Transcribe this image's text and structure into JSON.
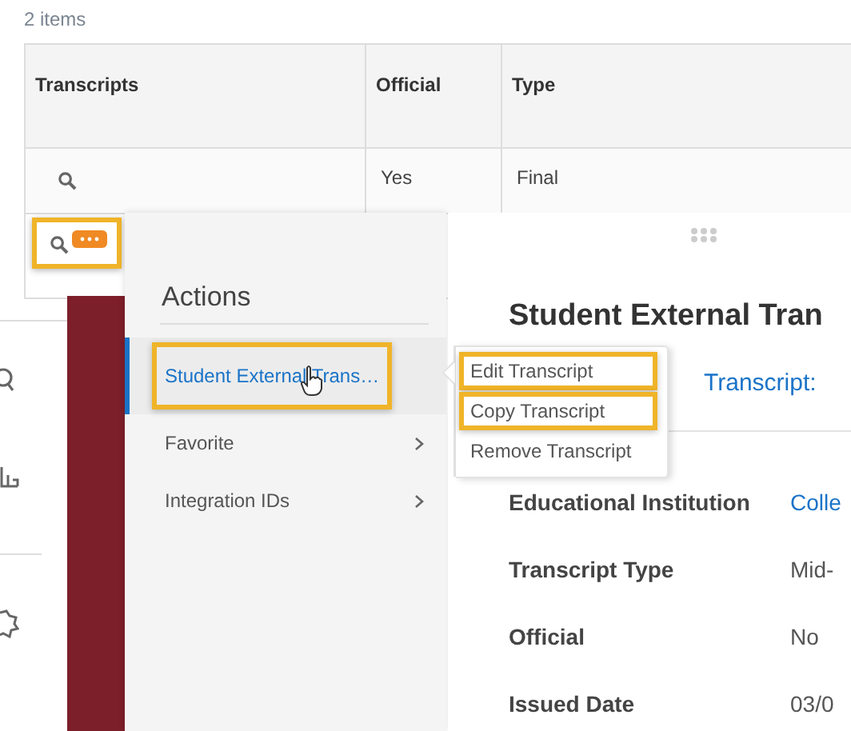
{
  "item_count": "2 items",
  "table": {
    "columns": [
      "Transcripts",
      "Official",
      "Type"
    ],
    "rows": [
      {
        "official": "Yes",
        "type": "Final",
        "has_actions": false,
        "highlighted": false
      },
      {
        "has_actions": true,
        "highlighted": true
      }
    ]
  },
  "actions_menu": {
    "title": "Actions",
    "items": [
      {
        "label": "Student External Trans…",
        "selected": true,
        "highlighted": true,
        "has_submenu": false
      },
      {
        "label": "Favorite",
        "selected": false,
        "highlighted": false,
        "has_submenu": true
      },
      {
        "label": "Integration IDs",
        "selected": false,
        "highlighted": false,
        "has_submenu": true
      }
    ]
  },
  "submenu": [
    {
      "label": "Edit Transcript",
      "highlighted": true
    },
    {
      "label": "Copy Transcript",
      "highlighted": true
    },
    {
      "label": "Remove Transcript",
      "highlighted": false
    }
  ],
  "detail": {
    "title": "Student External Tran",
    "subtitle": "Transcript:",
    "fields": [
      {
        "label": "Educational Institution",
        "value": "Colle",
        "link": true
      },
      {
        "label": "Transcript Type",
        "value": "Mid-",
        "link": false
      },
      {
        "label": "Official",
        "value": "No",
        "link": false
      },
      {
        "label": "Issued Date",
        "value": "03/0",
        "link": false
      }
    ]
  }
}
